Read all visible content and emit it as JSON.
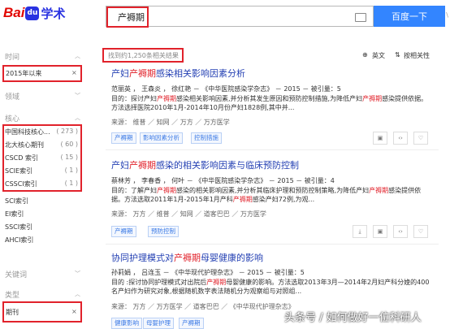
{
  "header": {
    "logo_bai": "Bai",
    "logo_paw": "du",
    "logo_xueshu": "学术",
    "search_value": "产褥期",
    "search_button": "百度一下",
    "corner": "\\"
  },
  "sidebar": {
    "time_title": "时间",
    "time_selected": "2015年以来",
    "domain_title": "领域",
    "core_title": "核心",
    "core_items": [
      {
        "label": "中国科技核心...",
        "count": "( 273 )"
      },
      {
        "label": "北大核心期刊",
        "count": "( 60 )"
      },
      {
        "label": "CSCD 索引",
        "count": "( 15 )"
      },
      {
        "label": "SCIE索引",
        "count": "( 1 )"
      },
      {
        "label": "CSSCI索引",
        "count": "( 1 )"
      }
    ],
    "more_items": [
      "SCI索引",
      "EI索引",
      "SSCI索引",
      "AHCI索引"
    ],
    "keyword_title": "关键词",
    "type_title": "类型",
    "type_selected": "期刊",
    "clear": "×"
  },
  "results_header": {
    "count": "找到约1,250条相关结果",
    "english": "英文",
    "sort": "按相关性"
  },
  "results": [
    {
      "title_pre": "产妇",
      "title_kw": "产褥期",
      "title_post": "感染相关影响因素分析",
      "authors": "范丽英 ， 王森炎 ， 徐红艳 － 《中华医院感染学杂志》 － 2015 － 被引量：5",
      "abs_pre": "目的：探讨产妇",
      "abs_kw": "产褥期",
      "abs_post": "感染相关影响因素,并分析其发生原因和预防控制措施,为降低产妇",
      "abs_kw2": "产褥期",
      "abs_post2": "感染提供依据。方法选择医院2010年1月-2014年10月份产妇1828例,其中并...",
      "source": "来源： 维普 ／ 知网 ／ 万方 ／ 万方医学",
      "tags": [
        "产褥期",
        "影响因素分析",
        "控制措施"
      ]
    },
    {
      "title_pre": "产妇",
      "title_kw": "产褥期",
      "title_post": "感染的相关影响因素与临床预防控制",
      "authors": "蔡林芳 ， 李春香 ， 何叶 － 《中华医院感染学杂志》 － 2015 － 被引量：4",
      "abs_pre": "目的：了解产妇",
      "abs_kw": "产褥期",
      "abs_post": "感染的相关影响因素,并分析其临床护理和预防控制策略,为降低产妇",
      "abs_kw2": "产褥期",
      "abs_post2": "感染提供依据。方法选取2011年1月-2015年1月产科",
      "abs_kw3": "产褥期",
      "abs_post3": "感染产妇72例,为观...",
      "source": "来源： 万方 ／ 维普 ／ 知网 ／ 道客巴巴 ／ 万方医学",
      "tags": [
        "产褥期",
        "预防控制"
      ]
    },
    {
      "title_pre": "协同护理模式对",
      "title_kw": "产褥期",
      "title_post": "母婴健康的影响",
      "authors": "孙莉娟 ， 吕连玉 － 《中华现代护理杂志》 － 2015 － 被引量：5",
      "abs_pre": "目的 :探讨协同护理模式对出院后",
      "abs_kw": "产褥期",
      "abs_post": "母婴健康的影响。方法选取2013年3月—2014年2月妇产科分娩的400名产妇作为研究对象,根据随机数字表法随机分为观察组与对照组...",
      "source": "来源： 万方 ／ 万方医学 ／ 道客巴巴 ／ 《中华现代护理杂志》",
      "tags": [
        "健康影响",
        "母婴护理",
        "产褥期"
      ]
    }
  ],
  "watermark": "头条号 / 如何做好一位科研人",
  "colors": {
    "accent": "#3385ff",
    "highlight": "#e1222b",
    "link": "#2440b3"
  }
}
